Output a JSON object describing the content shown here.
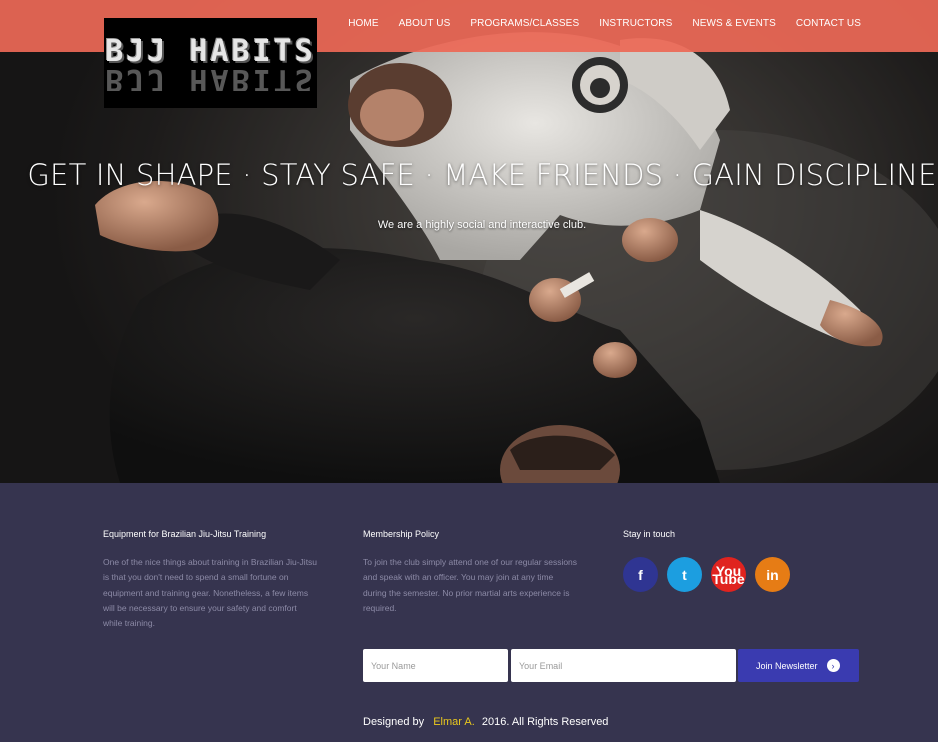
{
  "logo": {
    "text": "BJJ HABITS"
  },
  "nav": {
    "items": [
      "HOME",
      "ABOUT US",
      "PROGRAMS/CLASSES",
      "INSTRUCTORS",
      "NEWS & EVENTS",
      "CONTACT US"
    ]
  },
  "hero": {
    "headline": "GET IN SHAPE · STAY SAFE · MAKE FRIENDS · GAIN DISCIPLINE",
    "tagline": "We are a highly social and interactive club."
  },
  "footer": {
    "equipment": {
      "title": "Equipment for Brazilian Jiu-Jitsu Training",
      "lines": [
        "One of the nice things about training in Brazilian Jiu-Jitsu",
        "is that you don't need to spend a small fortune on",
        "equipment and training gear. Nonetheless, a few items",
        "will be necessary to ensure your safety and comfort",
        "while training."
      ]
    },
    "membership": {
      "title": "Membership Policy",
      "lines": [
        "To join the club simply attend one of our regular sessions",
        "and speak with an officer. You may join at any time",
        "during the semester. No prior martial arts experience is",
        "required."
      ]
    },
    "social": {
      "title": "Stay in touch",
      "icons": [
        "facebook-icon",
        "twitter-icon",
        "youtube-icon",
        "linkedin-icon"
      ],
      "glyphs": {
        "facebook": "f",
        "twitter": "t",
        "youtube_top": "You",
        "youtube_bottom": "Tube",
        "linkedin": "in"
      }
    },
    "newsletter": {
      "name_placeholder": "Your Name",
      "email_placeholder": "Your Email",
      "button_label": "Join Newsletter",
      "button_arrow": "›"
    },
    "credits": {
      "prefix": "Designed by",
      "author": "Elmar A.",
      "suffix": "2016. All Rights Reserved"
    }
  },
  "colors": {
    "topbar": "#ec6856",
    "footer_bg": "#36344f",
    "button": "#3a3bb0",
    "facebook": "#2f3592",
    "twitter": "#1c9ee0",
    "youtube": "#e0231f",
    "linkedin": "#e67c15",
    "author_link": "#e9c81e"
  }
}
